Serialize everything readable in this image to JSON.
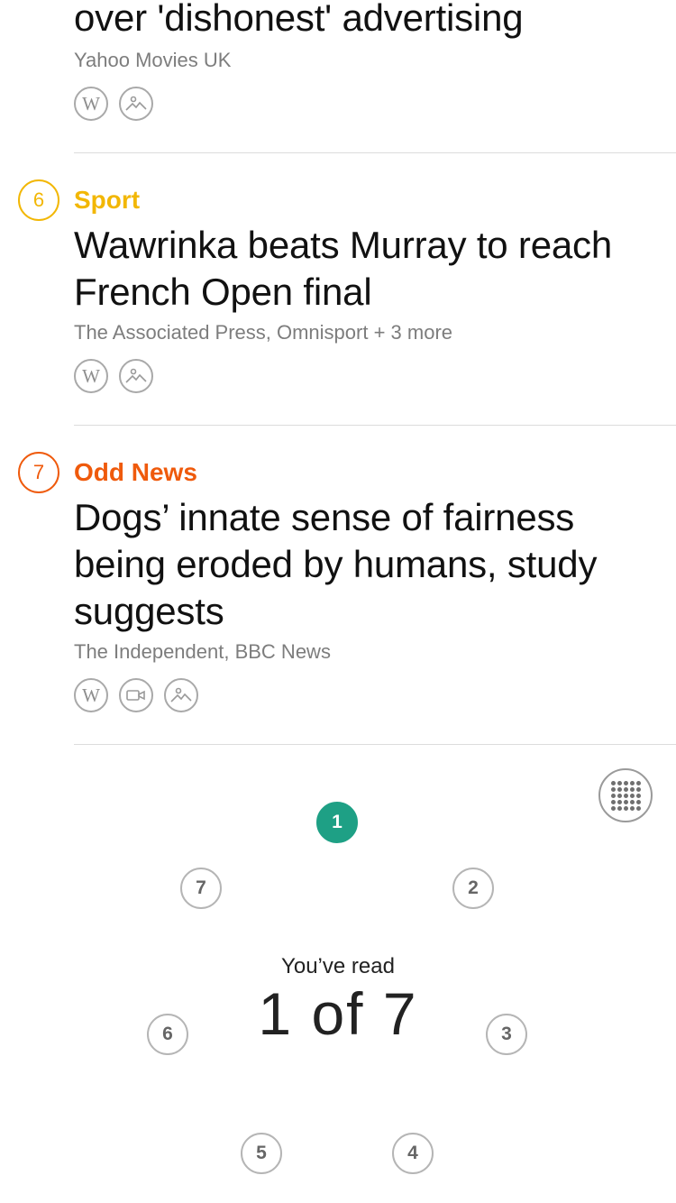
{
  "story5": {
    "headline_tail": "over 'dishonest' advertising",
    "source": "Yahoo Movies UK"
  },
  "story6": {
    "number": "6",
    "category": "Sport",
    "category_color": "#f2b705",
    "headline": "Wawrinka beats Murray to reach French Open final",
    "source": "The Associated Press, Omnisport + 3 more"
  },
  "story7": {
    "number": "7",
    "category": "Odd News",
    "category_color": "#ef5a0c",
    "headline": "Dogs’ innate sense of fairness being eroded by humans, study suggests",
    "source": "The Independent, BBC News"
  },
  "icons": {
    "wiki": "W"
  },
  "progress": {
    "label": "You’ve read",
    "count_text": "1 of 7",
    "read": 1,
    "total": 7,
    "active_color": "#1ea085",
    "items": [
      "1",
      "2",
      "3",
      "4",
      "5",
      "6",
      "7"
    ]
  }
}
